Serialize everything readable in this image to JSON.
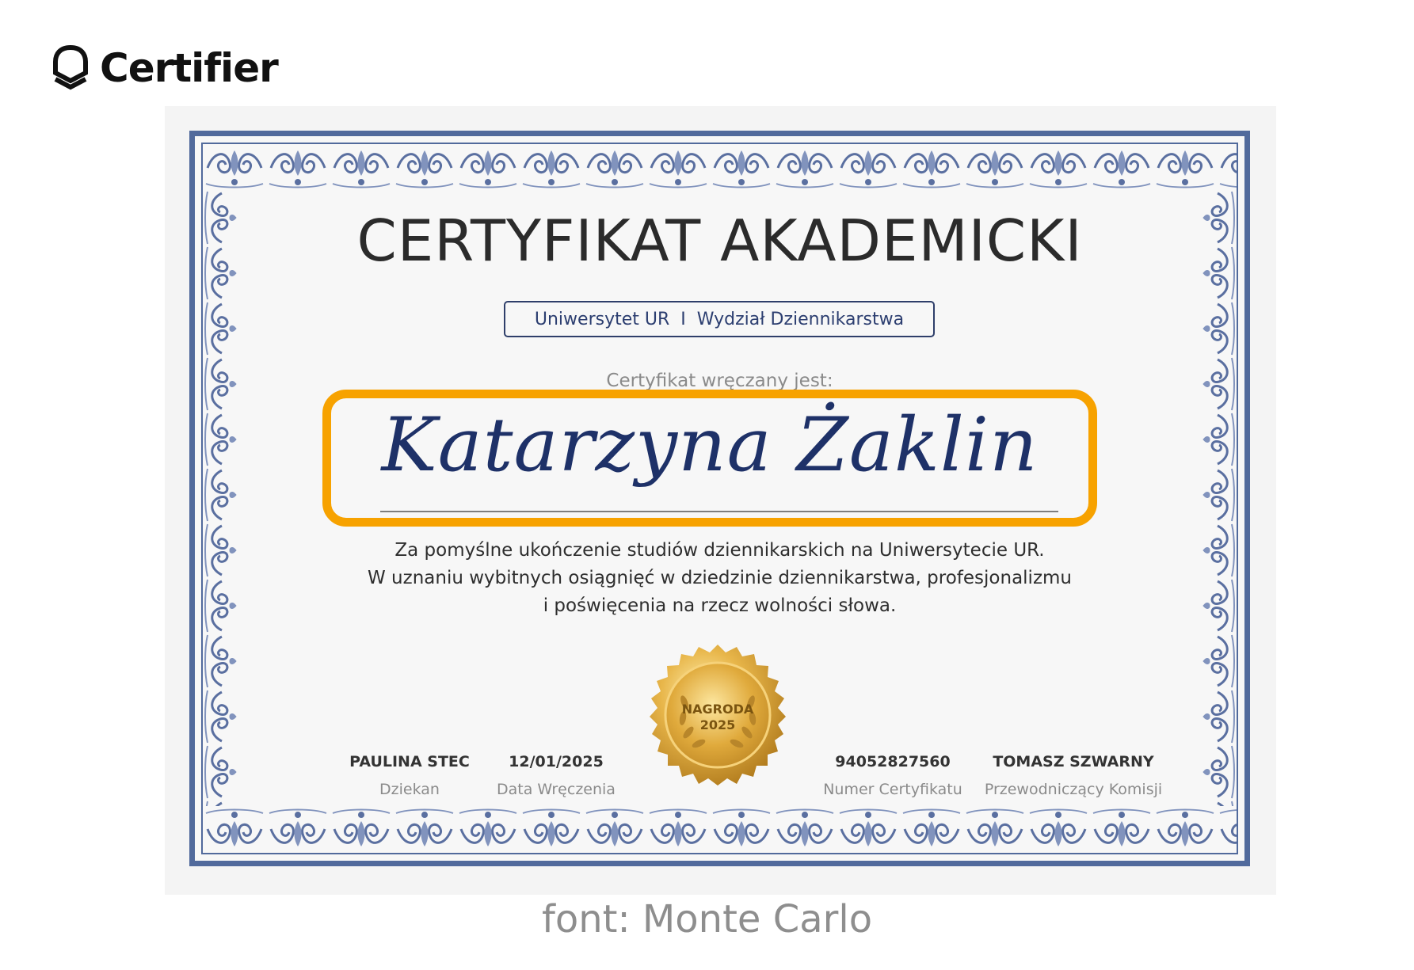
{
  "brand": {
    "name": "Certifier",
    "icon": "certifier-shield-icon"
  },
  "certificate": {
    "title": "CERTYFIKAT AKADEMICKI",
    "institution": {
      "university": "Uniwersytet UR",
      "separator": "I",
      "faculty": "Wydział Dziennikarstwa"
    },
    "presented_to_label": "Certyfikat wręczany jest:",
    "recipient_name": "Katarzyna Żaklin",
    "description_lines": [
      "Za pomyślne ukończenie studiów dziennikarskich na Uniwersytecie UR.",
      "W uznaniu wybitnych osiągnięć w dziedzinie dziennikarstwa, profesjonalizmu",
      "i poświęcenia na rzecz wolności słowa."
    ],
    "seal": {
      "line1": "NAGRODA",
      "line2": "2025",
      "icon": "laurel-wreath-icon"
    },
    "fields": [
      {
        "value": "PAULINA STEC",
        "label": "Dziekan"
      },
      {
        "value": "12/01/2025",
        "label": "Data Wręczenia"
      },
      {
        "value": "94052827560",
        "label": "Numer Certyfikatu"
      },
      {
        "value": "TOMASZ SZWARNY",
        "label": "Przewodniczący Komisji"
      }
    ]
  },
  "font_note": "font: Monte Carlo",
  "colors": {
    "frame": "#516a9c",
    "highlight": "#f7a200",
    "name": "#1e3168",
    "gold": "#d9a12f"
  }
}
